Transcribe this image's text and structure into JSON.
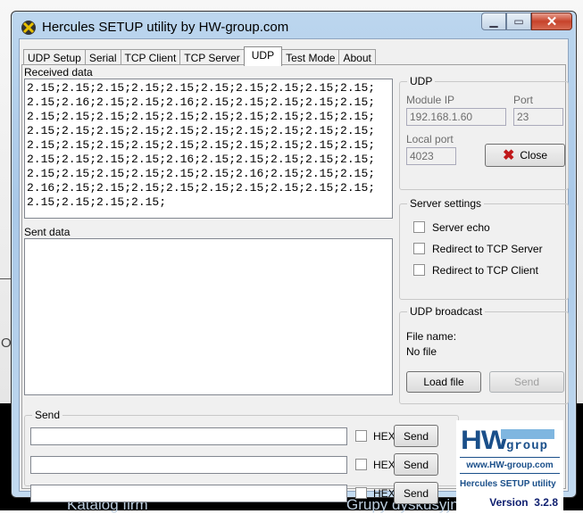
{
  "window": {
    "title": "Hercules SETUP utility by HW-group.com"
  },
  "tabs": [
    "UDP Setup",
    "Serial",
    "TCP Client",
    "TCP Server",
    "UDP",
    "Test Mode",
    "About"
  ],
  "active_tab": "UDP",
  "received": {
    "label": "Received data",
    "lines": [
      "2.15;2.15;2.15;2.15;2.15;2.15;2.15;2.15;2.15;2.15;",
      "2.15;2.16;2.15;2.15;2.16;2.15;2.15;2.15;2.15;2.15;",
      "2.15;2.15;2.15;2.15;2.15;2.15;2.15;2.15;2.15;2.15;",
      "2.15;2.15;2.15;2.15;2.15;2.15;2.15;2.15;2.15;2.15;",
      "2.15;2.15;2.15;2.15;2.15;2.15;2.15;2.15;2.15;2.15;",
      "2.15;2.15;2.15;2.15;2.16;2.15;2.15;2.15;2.15;2.15;",
      "2.15;2.15;2.15;2.15;2.15;2.15;2.16;2.15;2.15;2.15;",
      "2.16;2.15;2.15;2.15;2.15;2.15;2.15;2.15;2.15;2.15;",
      "2.15;2.15;2.15;2.15;"
    ]
  },
  "sent": {
    "label": "Sent data"
  },
  "udp": {
    "title": "UDP",
    "module_ip_label": "Module IP",
    "module_ip": "192.168.1.60",
    "port_label": "Port",
    "port": "23",
    "local_port_label": "Local port",
    "local_port": "4023",
    "close_label": "Close"
  },
  "server_settings": {
    "title": "Server settings",
    "options": [
      "Server echo",
      "Redirect to TCP Server",
      "Redirect to TCP Client"
    ]
  },
  "broadcast": {
    "title": "UDP broadcast",
    "file_name_label": "File name:",
    "file_name": "No file",
    "load_label": "Load file",
    "send_label": "Send"
  },
  "send": {
    "title": "Send",
    "rows": [
      {
        "value": "",
        "hex": "HEX",
        "button": "Send"
      },
      {
        "value": "",
        "hex": "HEX",
        "button": "Send"
      },
      {
        "value": "",
        "hex": "HEX",
        "button": "Send"
      }
    ]
  },
  "logo": {
    "brand": "HW",
    "group": "group",
    "url": "www.HW-group.com",
    "product": "Hercules SETUP utility",
    "version": "Version  3.2.8"
  },
  "background": {
    "left": "Katalog firm",
    "right": "Grupy dyskusyjne",
    "o": "O"
  },
  "colors": {
    "logo_blue": "#1a4f8a",
    "logo_light": "#7fb6e0",
    "close_x": "#c0181a"
  }
}
